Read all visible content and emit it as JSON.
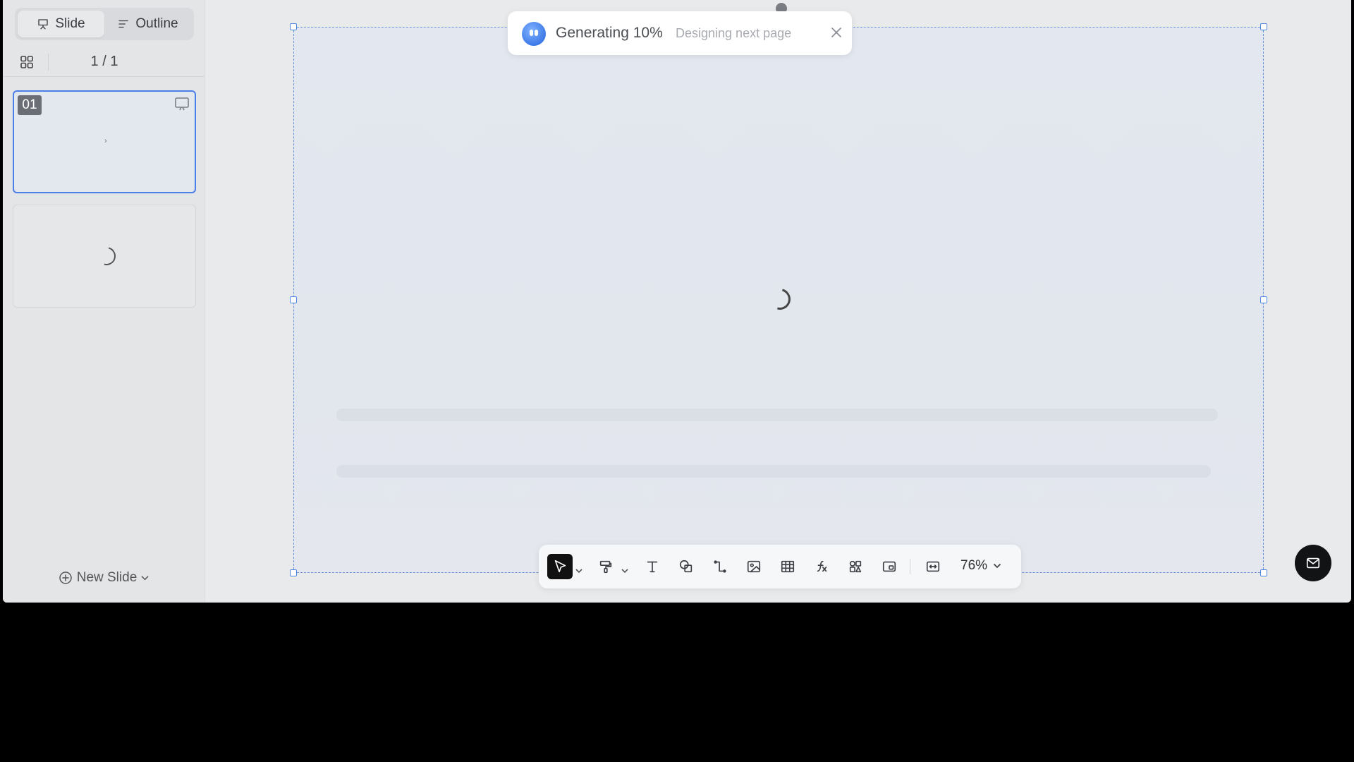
{
  "sidebar": {
    "view_toggle": {
      "slide_label": "Slide",
      "outline_label": "Outline",
      "active": "slide"
    },
    "page_counter": "1 / 1",
    "thumbnails": [
      {
        "number": "01",
        "selected": true
      },
      {
        "number": "",
        "loading": true
      }
    ],
    "new_slide_label": "New Slide"
  },
  "toast": {
    "title": "Generating 10%",
    "status": "Designing next page",
    "progress_percent": 10
  },
  "toolbar": {
    "zoom": "76%",
    "tools": [
      "select",
      "format-painter",
      "text",
      "shape",
      "connector",
      "image",
      "table",
      "formula",
      "icons",
      "media",
      "fit-width"
    ]
  },
  "colors": {
    "accent": "#4a80e8",
    "selection_border": "#6b93d6",
    "toast_avatar": "#3f7be8",
    "feedback_button": "#121315"
  }
}
